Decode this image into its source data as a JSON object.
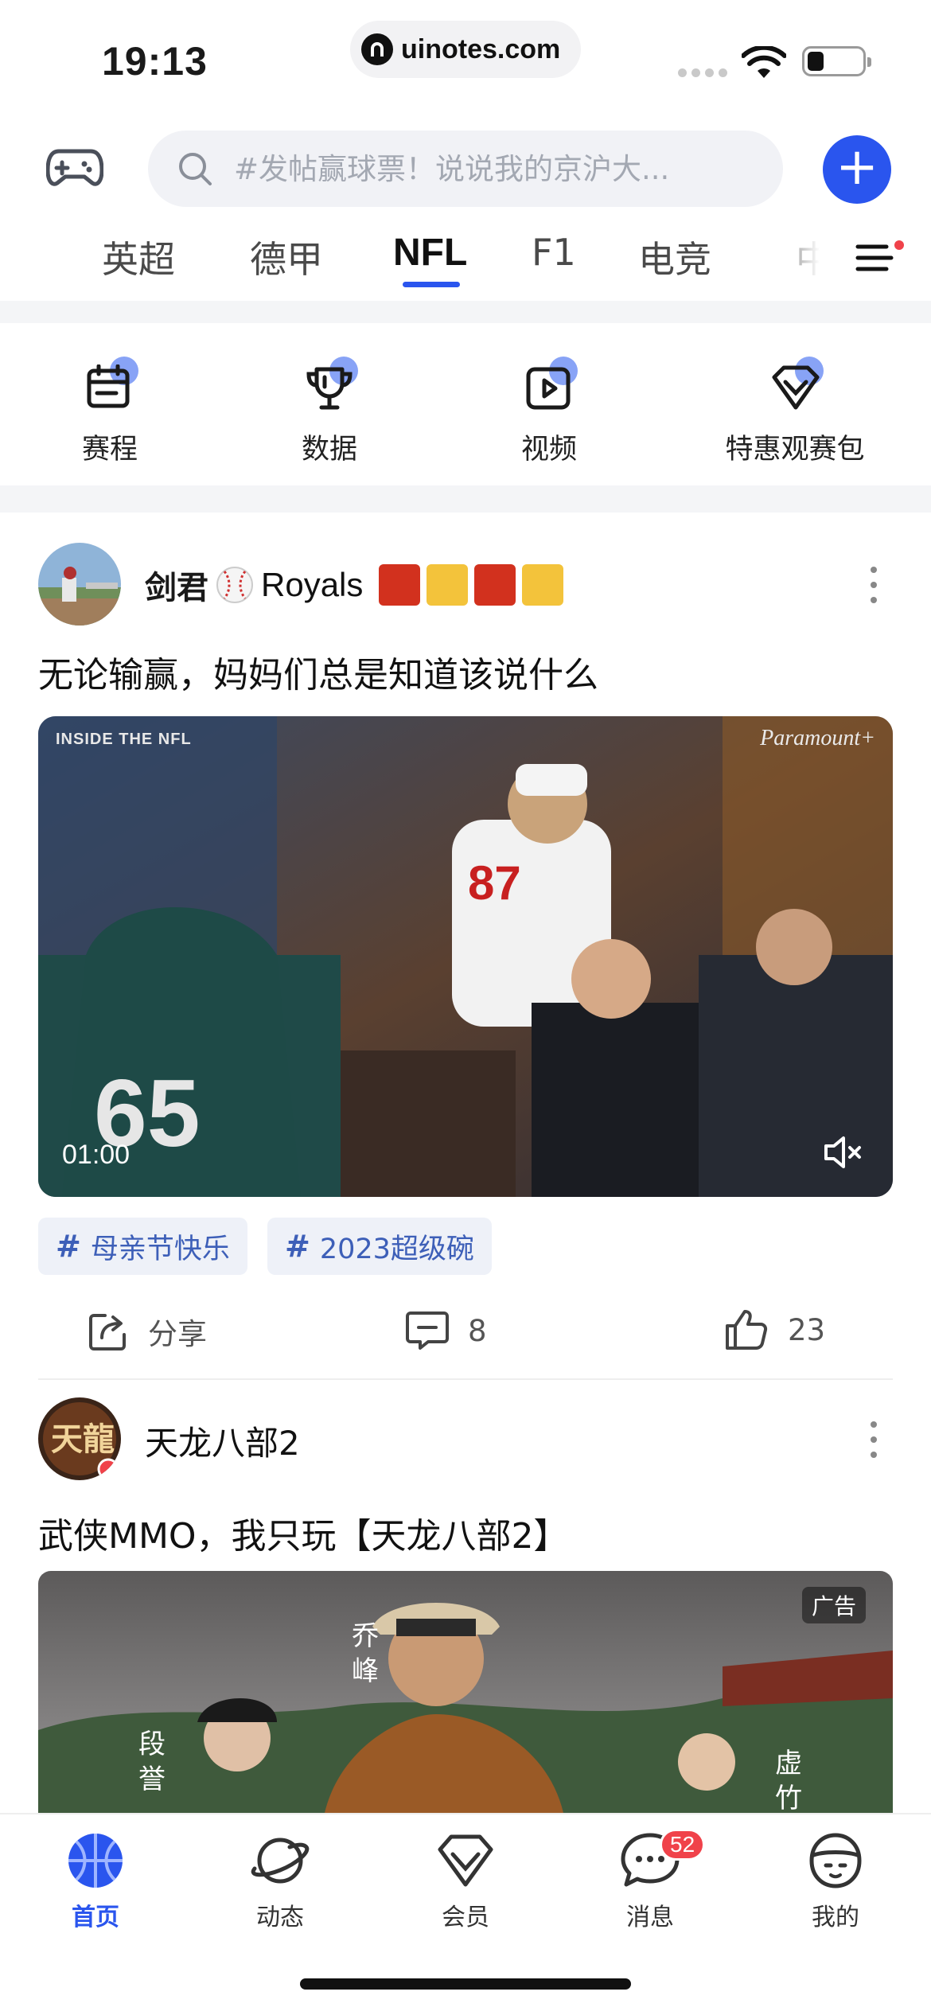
{
  "status_bar": {
    "time": "19:13",
    "url": "uinotes.com"
  },
  "search": {
    "placeholder": "#发帖赢球票！说说我的京沪大..."
  },
  "tabs": [
    {
      "label": "英超",
      "active": false
    },
    {
      "label": "德甲",
      "active": false
    },
    {
      "label": "NFL",
      "active": true
    },
    {
      "label": "F1",
      "active": false
    },
    {
      "label": "电竞",
      "active": false
    },
    {
      "label": "中",
      "active": false
    }
  ],
  "quick_links": [
    {
      "label": "赛程",
      "icon": "calendar-icon"
    },
    {
      "label": "数据",
      "icon": "trophy-icon"
    },
    {
      "label": "视频",
      "icon": "video-icon"
    },
    {
      "label": "特惠观赛包",
      "icon": "diamond-icon"
    }
  ],
  "posts": [
    {
      "author": "剑君",
      "author_suffix": "Royals",
      "title": "无论输赢，妈妈们总是知道该说什么",
      "media_brand_left": "INSIDE THE NFL",
      "media_brand_right": "Paramount+",
      "duration": "01:00",
      "tags": [
        "母亲节快乐",
        "2023超级碗"
      ],
      "share_label": "分享",
      "comments": "8",
      "likes": "23"
    },
    {
      "author": "天龙八部2",
      "title": "武侠MMO，我只玩【天龙八部2】",
      "ad_label": "广告",
      "names": [
        "乔峰",
        "段誉",
        "虚竹"
      ]
    }
  ],
  "bottom_nav": [
    {
      "label": "首页",
      "icon": "basketball-icon",
      "active": true
    },
    {
      "label": "动态",
      "icon": "planet-icon",
      "active": false
    },
    {
      "label": "会员",
      "icon": "diamond-icon",
      "active": false
    },
    {
      "label": "消息",
      "icon": "chat-icon",
      "active": false,
      "badge": "52"
    },
    {
      "label": "我的",
      "icon": "profile-icon",
      "active": false
    }
  ],
  "colors": {
    "accent": "#2a55ee",
    "badge": "#f0424a",
    "tag_text": "#3d5fb8"
  }
}
